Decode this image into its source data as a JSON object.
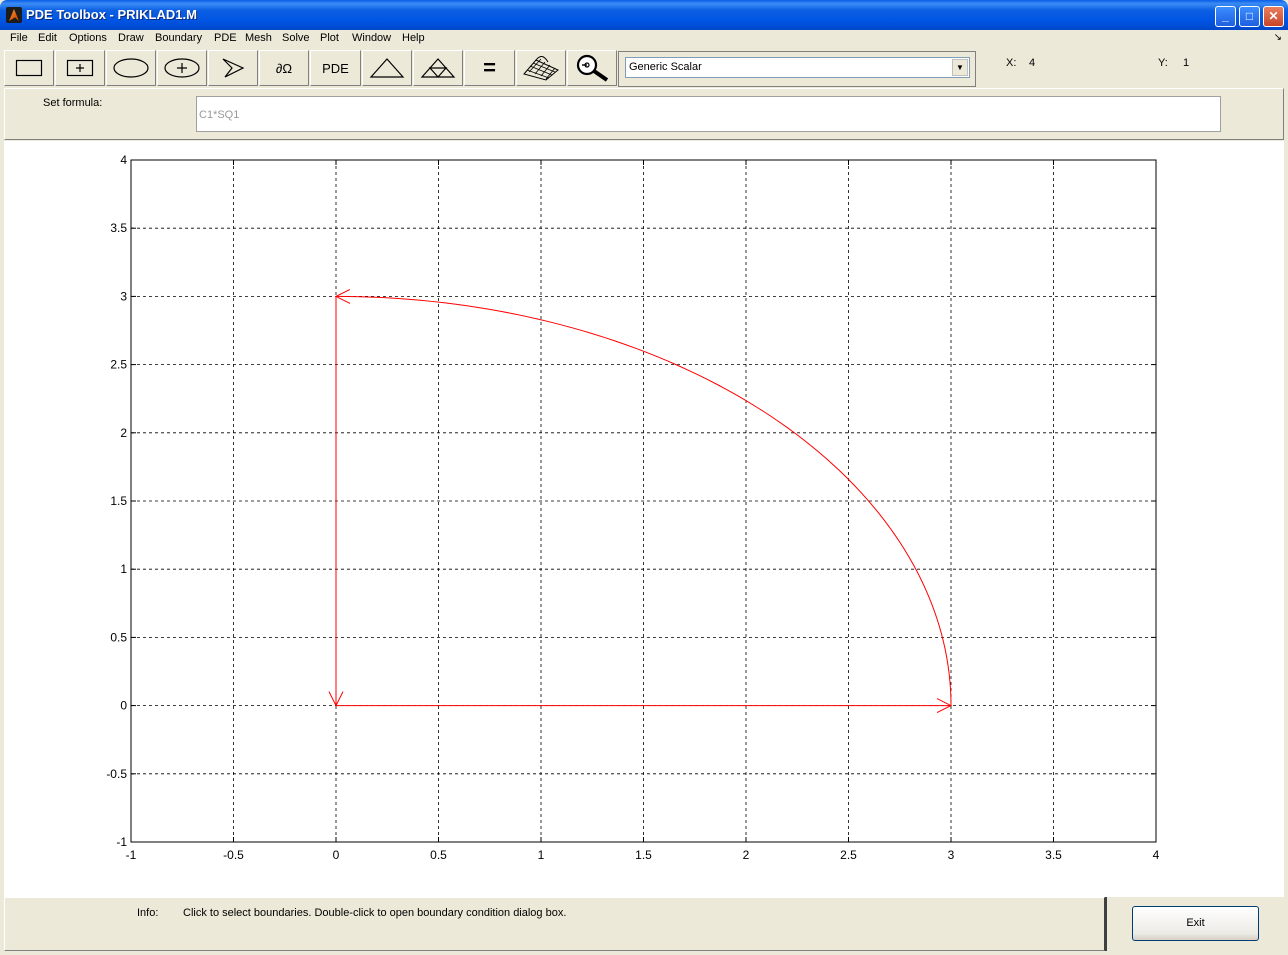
{
  "window": {
    "title": "PDE Toolbox - PRIKLAD1.M"
  },
  "menu": [
    "File",
    "Edit",
    "Options",
    "Draw",
    "Boundary",
    "PDE",
    "Mesh",
    "Solve",
    "Plot",
    "Window",
    "Help"
  ],
  "toolbar": {
    "buttons": [
      {
        "name": "draw-rectangle",
        "icon": "rectangle-icon"
      },
      {
        "name": "draw-rectangle-center",
        "icon": "rectangle-center-icon"
      },
      {
        "name": "draw-ellipse",
        "icon": "ellipse-icon"
      },
      {
        "name": "draw-ellipse-center",
        "icon": "ellipse-center-icon"
      },
      {
        "name": "draw-polygon",
        "icon": "polygon-icon"
      },
      {
        "name": "boundary-mode",
        "label": "∂Ω"
      },
      {
        "name": "pde-specification",
        "label": "PDE"
      },
      {
        "name": "init-mesh",
        "icon": "triangle-icon"
      },
      {
        "name": "refine-mesh",
        "icon": "refined-triangle-icon"
      },
      {
        "name": "solve-pde",
        "label": "="
      },
      {
        "name": "plot-solution",
        "icon": "surface-plot-icon"
      },
      {
        "name": "zoom",
        "icon": "magnifier-icon"
      }
    ],
    "application_mode": "Generic Scalar"
  },
  "coords": {
    "x_label": "X:",
    "x_value": "4",
    "y_label": "Y:",
    "y_value": "1"
  },
  "formula": {
    "label": "Set formula:",
    "value": "C1*SQ1"
  },
  "status": {
    "info_label": "Info:",
    "info_text": "Click to select boundaries. Double-click to open boundary condition dialog box."
  },
  "exit_label": "Exit",
  "chart_data": {
    "type": "line",
    "xlim": [
      -1,
      4
    ],
    "ylim": [
      -1,
      4
    ],
    "xticks": [
      "-1",
      "-0.5",
      "0",
      "0.5",
      "1",
      "1.5",
      "2",
      "2.5",
      "3",
      "3.5",
      "4"
    ],
    "yticks": [
      "-1",
      "-0.5",
      "0",
      "0.5",
      "1",
      "1.5",
      "2",
      "2.5",
      "3",
      "3.5",
      "4"
    ],
    "grid": true,
    "boundary_color": "#ff0000",
    "segments": [
      {
        "name": "bottom-edge",
        "kind": "line",
        "from": [
          0,
          0
        ],
        "to": [
          3,
          0
        ],
        "arrow_at": [
          3,
          0
        ]
      },
      {
        "name": "arc-edge",
        "kind": "arc",
        "center": [
          0,
          0
        ],
        "radius": 3,
        "from_deg": 0,
        "to_deg": 90,
        "arrow_at": [
          0,
          3
        ]
      },
      {
        "name": "left-edge",
        "kind": "line",
        "from": [
          0,
          3
        ],
        "to": [
          0,
          0
        ],
        "arrow_at": [
          0,
          0
        ]
      }
    ]
  }
}
